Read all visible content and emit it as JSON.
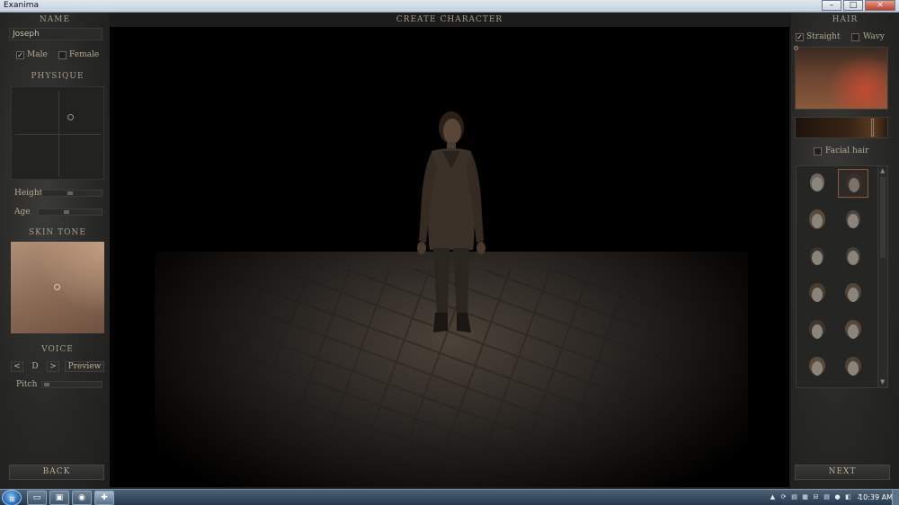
{
  "window": {
    "title": "Exanima",
    "controls": [
      "–",
      "□",
      "✕"
    ]
  },
  "left_panel": {
    "name_header": "NAME",
    "name_value": "Joseph",
    "gender": {
      "male_label": "Male",
      "female_label": "Female",
      "male_checked": true,
      "female_checked": false
    },
    "physique_header": "PHYSIQUE",
    "height_label": "Height",
    "age_label": "Age",
    "skin_header": "SKIN TONE",
    "voice_header": "VOICE",
    "voice_prev": "<",
    "voice_value": "D",
    "voice_next": ">",
    "preview_label": "Preview",
    "pitch_label": "Pitch",
    "back_label": "BACK"
  },
  "center": {
    "title": "CREATE CHARACTER"
  },
  "right_panel": {
    "hair_header": "HAIR",
    "straight_label": "Straight",
    "wavy_label": "Wavy",
    "straight_checked": true,
    "wavy_checked": false,
    "facial_hair_label": "Facial hair",
    "facial_hair_checked": false,
    "selected_style_index": 1,
    "scroll_up": "▲",
    "scroll_down": "▼",
    "next_label": "NEXT"
  },
  "taskbar": {
    "start_glyph": "⊞",
    "tasks": [
      "▭",
      "▣",
      "◉",
      "✚"
    ],
    "tray": [
      "▲",
      "⟳",
      "▤",
      "▦",
      "⊟",
      "▤",
      "●",
      "◧",
      "♪"
    ],
    "clock": "10:39 AM"
  }
}
